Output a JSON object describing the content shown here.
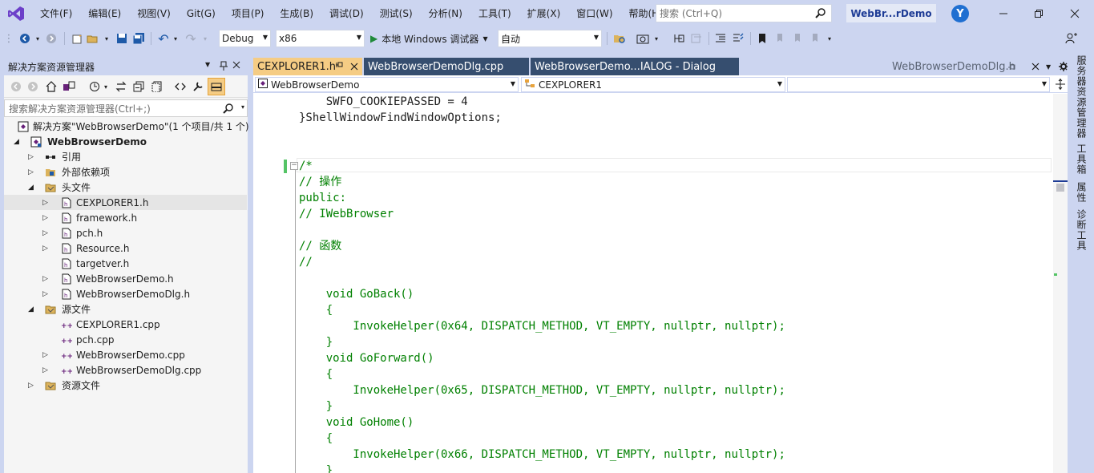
{
  "menubar": {
    "items": [
      "文件(F)",
      "编辑(E)",
      "视图(V)",
      "Git(G)",
      "项目(P)",
      "生成(B)",
      "调试(D)",
      "测试(S)",
      "分析(N)",
      "工具(T)",
      "扩展(X)",
      "窗口(W)",
      "帮助(H)"
    ],
    "search_placeholder": "搜索 (Ctrl+Q)",
    "solution_badge": "WebBr...rDemo",
    "avatar_initial": "Y"
  },
  "toolbar": {
    "config": "Debug",
    "platform": "x86",
    "run_label": "本地 Windows 调试器",
    "run_mode": "自动"
  },
  "solution_explorer": {
    "title": "解决方案资源管理器",
    "search_placeholder": "搜索解决方案资源管理器(Ctrl+;)",
    "tree": [
      {
        "label": "解决方案\"WebBrowserDemo\"(1 个项目/共 1 个)",
        "icon": "solution-icon"
      },
      {
        "label": "WebBrowserDemo",
        "icon": "project-icon",
        "bold": true
      },
      {
        "label": "引用",
        "icon": "references-icon"
      },
      {
        "label": "外部依赖项",
        "icon": "external-deps-icon"
      },
      {
        "label": "头文件",
        "icon": "folder-icon"
      },
      {
        "label": "CEXPLORER1.h",
        "icon": "header-file-icon",
        "selected": true
      },
      {
        "label": "framework.h",
        "icon": "header-file-icon"
      },
      {
        "label": "pch.h",
        "icon": "header-file-icon"
      },
      {
        "label": "Resource.h",
        "icon": "header-file-icon"
      },
      {
        "label": "targetver.h",
        "icon": "header-file-icon"
      },
      {
        "label": "WebBrowserDemo.h",
        "icon": "header-file-icon"
      },
      {
        "label": "WebBrowserDemoDlg.h",
        "icon": "header-file-icon"
      },
      {
        "label": "源文件",
        "icon": "folder-icon"
      },
      {
        "label": "CEXPLORER1.cpp",
        "icon": "cpp-file-icon"
      },
      {
        "label": "pch.cpp",
        "icon": "cpp-file-icon"
      },
      {
        "label": "WebBrowserDemo.cpp",
        "icon": "cpp-file-icon"
      },
      {
        "label": "WebBrowserDemoDlg.cpp",
        "icon": "cpp-file-icon"
      },
      {
        "label": "资源文件",
        "icon": "folder-icon"
      }
    ]
  },
  "editor": {
    "tabs": [
      {
        "label": "CEXPLORER1.h",
        "active": true
      },
      {
        "label": "WebBrowserDemoDlg.cpp"
      },
      {
        "label": "WebBrowserDemo...IALOG - Dialog"
      }
    ],
    "right_tab": "WebBrowserDemoDlg.h",
    "nav_project": "WebBrowserDemo",
    "nav_class": "CEXPLORER1",
    "nav_member": "",
    "code_lines": [
      "    SWFO_COOKIEPASSED = 4",
      "}ShellWindowFindWindowOptions;",
      "",
      "",
      "/*",
      "// 操作",
      "public:",
      "// IWebBrowser",
      "",
      "// 函数",
      "//",
      "",
      "    void GoBack()",
      "    {",
      "        InvokeHelper(0x64, DISPATCH_METHOD, VT_EMPTY, nullptr, nullptr);",
      "    }",
      "    void GoForward()",
      "    {",
      "        InvokeHelper(0x65, DISPATCH_METHOD, VT_EMPTY, nullptr, nullptr);",
      "    }",
      "    void GoHome()",
      "    {",
      "        InvokeHelper(0x66, DISPATCH_METHOD, VT_EMPTY, nullptr, nullptr);",
      "    }"
    ]
  },
  "right_dock": [
    "服务器资源管理器",
    "工具箱",
    "属性",
    "诊断工具"
  ],
  "colors": {
    "chrome": "#ccd5f0",
    "active_tab": "#f5cc84",
    "inactive_tab": "#364e6f",
    "comment": "#008000",
    "accent": "#1e3c96"
  }
}
